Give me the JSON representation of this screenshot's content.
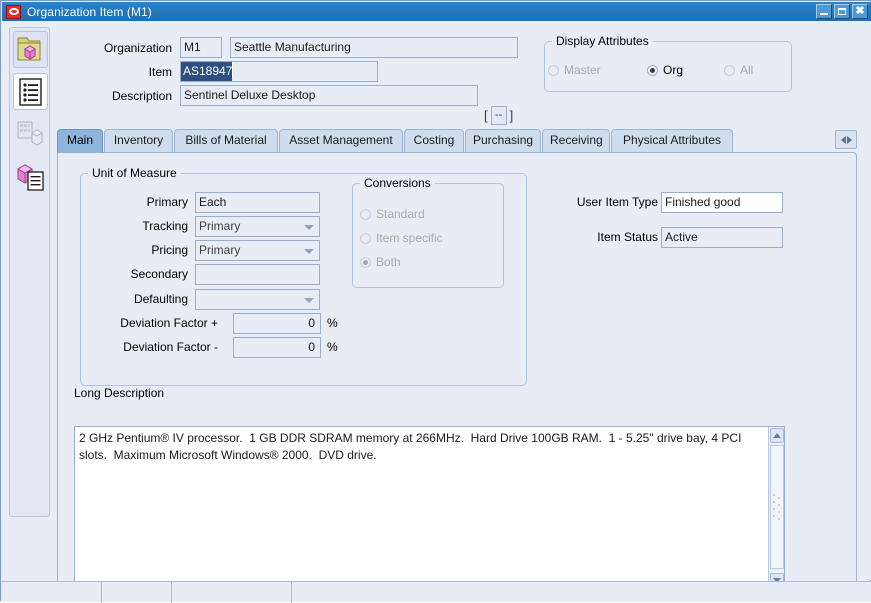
{
  "window": {
    "title": "Organization Item (M1)",
    "icon": "oracle-logo-icon",
    "buttons": {
      "minimize": "minimize-button",
      "maximize": "maximize-button",
      "close": "close-button"
    }
  },
  "sidebar": {
    "items": [
      {
        "name": "folder-cube-icon",
        "label": ""
      },
      {
        "name": "document-list-icon",
        "label": ""
      },
      {
        "name": "building-cube-icon",
        "label": ""
      },
      {
        "name": "cube-list-icon",
        "label": ""
      }
    ]
  },
  "header": {
    "organization_label": "Organization",
    "organization_code": "M1",
    "organization_name": "Seattle Manufacturing",
    "item_label": "Item",
    "item_value": "AS18947",
    "description_label": "Description",
    "description_value": "Sentinel Deluxe Desktop",
    "flex_open": "[",
    "flex_button": "--",
    "flex_close": "]"
  },
  "display_attributes": {
    "title": "Display Attributes",
    "options": [
      {
        "label": "Master",
        "mnemonic": "M",
        "selected": false,
        "disabled": true
      },
      {
        "label": "Org",
        "mnemonic": "O",
        "selected": true,
        "disabled": false
      },
      {
        "label": "All",
        "mnemonic": "A",
        "selected": false,
        "disabled": true
      }
    ]
  },
  "tabs": {
    "items": [
      {
        "label": "Main",
        "active": true
      },
      {
        "label": "Inventory",
        "active": false
      },
      {
        "label": "Bills of Material",
        "active": false
      },
      {
        "label": "Asset Management",
        "active": false
      },
      {
        "label": "Costing",
        "active": false
      },
      {
        "label": "Purchasing",
        "active": false
      },
      {
        "label": "Receiving",
        "active": false
      },
      {
        "label": "Physical Attributes",
        "active": false
      }
    ],
    "scroll_button": "tab-scroll-button"
  },
  "uom": {
    "title": "Unit of Measure",
    "primary_label": "Primary",
    "primary_value": "Each",
    "tracking_label": "Tracking",
    "tracking_value": "Primary",
    "pricing_label": "Pricing",
    "pricing_value": "Primary",
    "secondary_label": "Secondary",
    "secondary_value": "",
    "defaulting_label": "Defaulting",
    "defaulting_value": "",
    "dev_plus_label": "Deviation Factor +",
    "dev_plus_value": "0",
    "dev_plus_unit": "%",
    "dev_minus_label": "Deviation Factor -",
    "dev_minus_value": "0",
    "dev_minus_unit": "%"
  },
  "conversions": {
    "title": "Conversions",
    "options": [
      {
        "label": "Standard",
        "mnemonic": "S",
        "selected": false,
        "disabled": true
      },
      {
        "label": "Item specific",
        "mnemonic": "I",
        "selected": false,
        "disabled": true
      },
      {
        "label": "Both",
        "mnemonic": "B",
        "selected": true,
        "disabled": true
      }
    ]
  },
  "right_fields": {
    "user_item_type_label": "User Item Type",
    "user_item_type_value": "Finished good",
    "item_status_label": "Item Status",
    "item_status_value": "Active"
  },
  "long_description": {
    "label": "Long Description",
    "text": "2 GHz Pentium® IV processor.  1 GB DDR SDRAM memory at 266MHz.  Hard Drive 100GB RAM.  1 - 5.25\" drive bay, 4 PCI slots.  Maximum Microsoft Windows® 2000.  DVD drive."
  },
  "colors": {
    "title_bar": "#2378bd",
    "canvas": "#e8ecf5",
    "field_border": "#9aadc9",
    "active_tab": "#8fb4dc",
    "inactive_tab": "#cfdcee",
    "selection": "#2f4f82"
  }
}
